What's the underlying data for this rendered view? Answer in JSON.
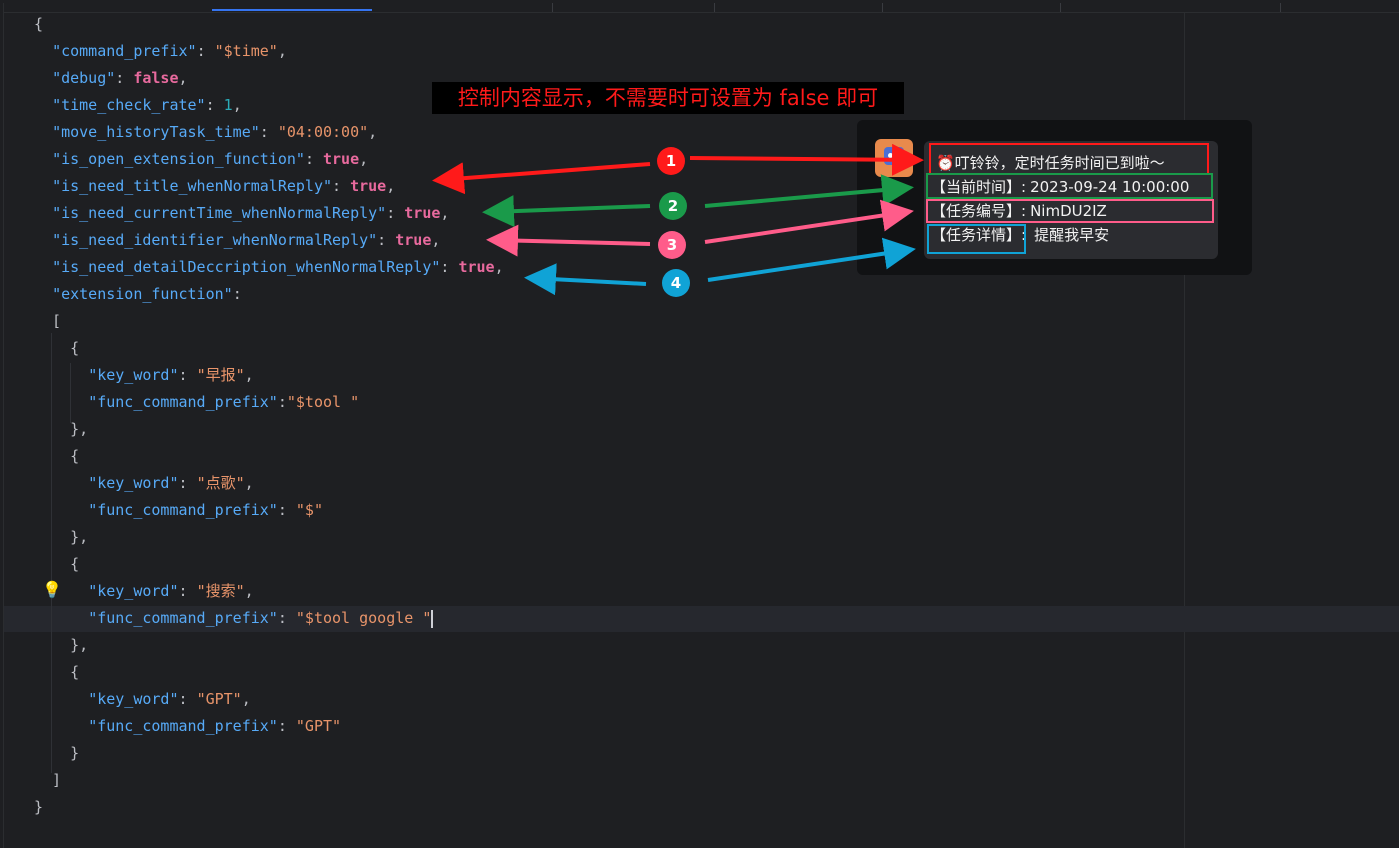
{
  "code_lines": [
    "{",
    "  \"command_prefix\": \"$time\",",
    "  \"debug\": false,",
    "  \"time_check_rate\": 1,",
    "  \"move_historyTask_time\": \"04:00:00\",",
    "  \"is_open_extension_function\": true,",
    "  \"is_need_title_whenNormalReply\": true,",
    "  \"is_need_currentTime_whenNormalReply\": true,",
    "  \"is_need_identifier_whenNormalReply\": true,",
    "  \"is_need_detailDeccription_whenNormalReply\": true,",
    "  \"extension_function\":",
    "  [",
    "    {",
    "      \"key_word\": \"早报\",",
    "      \"func_command_prefix\":\"$tool \"",
    "    },",
    "    {",
    "      \"key_word\": \"点歌\",",
    "      \"func_command_prefix\": \"$\"",
    "    },",
    "    {",
    "      \"key_word\": \"搜索\",",
    "      \"func_command_prefix\": \"$tool google \"",
    "    },",
    "    {",
    "      \"key_word\": \"GPT\",",
    "      \"func_command_prefix\": \"GPT\"",
    "    }",
    "  ]",
    "}"
  ],
  "annotation": {
    "title": "控制内容显示，不需要时可设置为 false 即可"
  },
  "chat_message": {
    "title_line": "⏰叮铃铃，定时任务时间已到啦～",
    "current_time_label": "【当前时间】:",
    "current_time_value": "2023-09-24 10:00:00",
    "identifier_label": "【任务编号】:",
    "identifier_value": "NimDU2IZ",
    "detail_label": "【任务详情】:",
    "detail_value": "提醒我早安"
  },
  "badges": [
    "1",
    "2",
    "3",
    "4"
  ],
  "colors": {
    "badge1": "#ff1a1a",
    "badge2": "#1a9a4a",
    "badge3": "#ff5c8a",
    "badge4": "#10a3d6"
  }
}
